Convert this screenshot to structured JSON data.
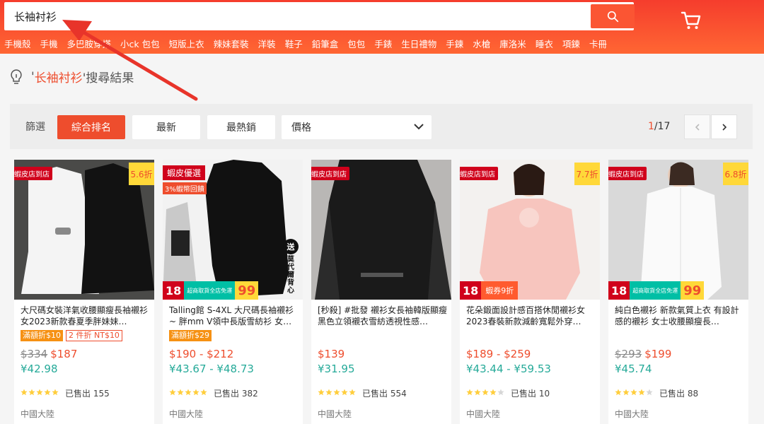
{
  "search": {
    "value": "长袖衬衫",
    "hot_words": [
      "手機殼",
      "手機",
      "多巴胺穿搭",
      "小ck 包包",
      "短版上衣",
      "辣妹套裝",
      "洋裝",
      "鞋子",
      "鉛筆盒",
      "包包",
      "手錶",
      "生日禮物",
      "手鍊",
      "水槍",
      "庫洛米",
      "睡衣",
      "項鍊",
      "卡冊"
    ]
  },
  "result": {
    "prefix": "'",
    "keyword": "长袖衬衫",
    "suffix": "'搜尋結果"
  },
  "filter": {
    "label": "篩選",
    "sorts": [
      "綜合排名",
      "最新",
      "最熱銷"
    ],
    "price_label": "價格",
    "page_current": "1",
    "page_total": "/17"
  },
  "colors": {
    "brand": "#ee4d2d",
    "rmb": "#26aa99",
    "star": "#ffce3d"
  },
  "products": [
    {
      "title": "大尺碼女裝洋氣收腰顯瘦長袖襯衫女2023新款春夏季胖妹妹…",
      "tags": [
        "滿額折$10",
        "2 件折 NT$10"
      ],
      "orig_price": "$334",
      "price": "$187",
      "rmb": "¥42.98",
      "stars": 5,
      "sold": "已售出 155",
      "origin": "中國大陸",
      "badge_shop": "蝦皮店到店",
      "badge_off": "5.6折"
    },
    {
      "title": "Talling館 S-4XL 大尺碼長袖襯衫 ~ 胖mm V領中長版雪紡衫 女…",
      "tags": [
        "滿額折$29"
      ],
      "orig_price": "",
      "price": "$190 - $212",
      "rmb": "¥43.67 - ¥48.73",
      "stars": 5,
      "sold": "已售出 382",
      "origin": "中國大陸",
      "badge_mall": "蝦皮優選",
      "badge_mall_sub": "3%蝦幣回饋",
      "gift_circle": "送",
      "gift_text": "莫代爾背心",
      "badge_18": "18",
      "badge_18_text": "超商取貨全店免運",
      "badge_18_big": "99"
    },
    {
      "title": "[秒殺] #批發 襯衫女長袖韓版顯瘦黑色立領襯衣雪紡透視性感…",
      "tags": [],
      "orig_price": "",
      "price": "$139",
      "rmb": "¥31.95",
      "stars": 5,
      "sold": "已售出 554",
      "origin": "中國大陸",
      "badge_shop": "蝦皮店到店"
    },
    {
      "title": "花朵鍛面設計感百搭休閒襯衫女2023春裝新款減齡寬鬆外穿…",
      "tags": [],
      "orig_price": "",
      "price": "$189 - $259",
      "rmb": "¥43.44 - ¥59.53",
      "stars": 4,
      "sold": "已售出 10",
      "origin": "中國大陸",
      "badge_shop": "蝦皮店到店",
      "badge_off": "7.7折",
      "badge_18": "18",
      "badge_18_voucher": "蝦券9折"
    },
    {
      "title": "純白色襯衫 新款氣質上衣 有設計感的襯衫 女士收腰顯瘦長…",
      "tags": [],
      "orig_price": "$293",
      "price": "$199",
      "rmb": "¥45.74",
      "stars": 4,
      "sold": "已售出 88",
      "origin": "中國大陸",
      "badge_shop": "蝦皮店到店",
      "badge_off": "6.8折",
      "badge_18": "18",
      "badge_18_text": "超商取貨全店免運",
      "badge_18_big": "99"
    }
  ]
}
